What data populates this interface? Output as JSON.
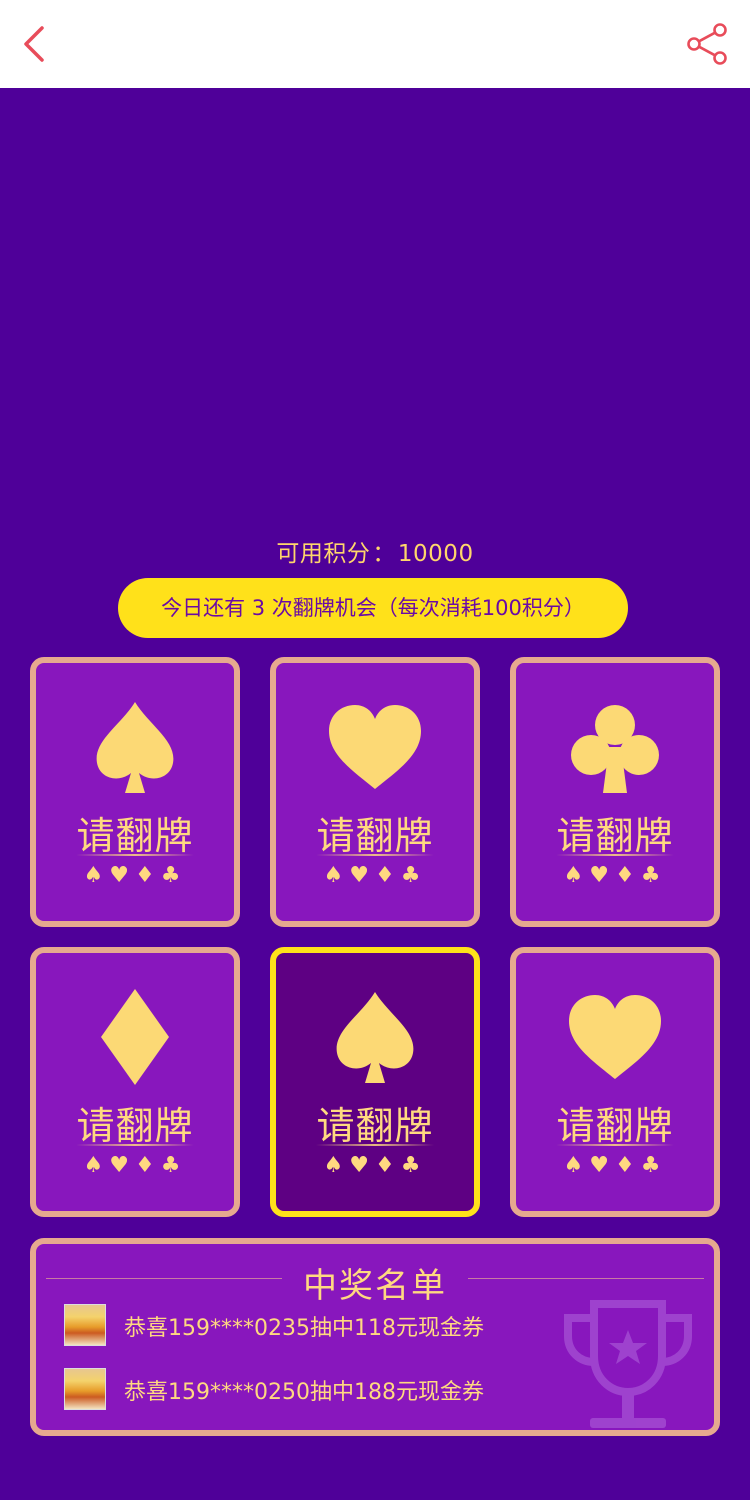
{
  "header": {
    "back_icon": "chevron-left-icon",
    "share_icon": "share-icon",
    "accent_color": "#e84c5a"
  },
  "points": {
    "label": "可用积分",
    "separator": "：",
    "value": "10000"
  },
  "chance": {
    "text": "今日还有 3 次翻牌机会（每次消耗100积分）"
  },
  "cards": [
    {
      "suit": "spade",
      "label": "请翻牌",
      "mini_suits": "♠♥♦♣",
      "selected": false
    },
    {
      "suit": "heart",
      "label": "请翻牌",
      "mini_suits": "♠♥♦♣",
      "selected": false
    },
    {
      "suit": "club",
      "label": "请翻牌",
      "mini_suits": "♠♥♦♣",
      "selected": false
    },
    {
      "suit": "diamond",
      "label": "请翻牌",
      "mini_suits": "♠♥♦♣",
      "selected": false
    },
    {
      "suit": "spade",
      "label": "请翻牌",
      "mini_suits": "♠♥♦♣",
      "selected": true
    },
    {
      "suit": "heart",
      "label": "请翻牌",
      "mini_suits": "♠♥♦♣",
      "selected": false
    }
  ],
  "winners": {
    "title": "中奖名单",
    "trophy_icon": "trophy-icon",
    "items": [
      {
        "text": "恭喜159****0235抽中118元现金券"
      },
      {
        "text": "恭喜159****0250抽中188元现金券"
      }
    ]
  },
  "colors": {
    "background": "#4f0099",
    "card": "#8817bd",
    "card_selected": "#5e0083",
    "gold": "#ffd980",
    "pill": "#ffe11a"
  }
}
